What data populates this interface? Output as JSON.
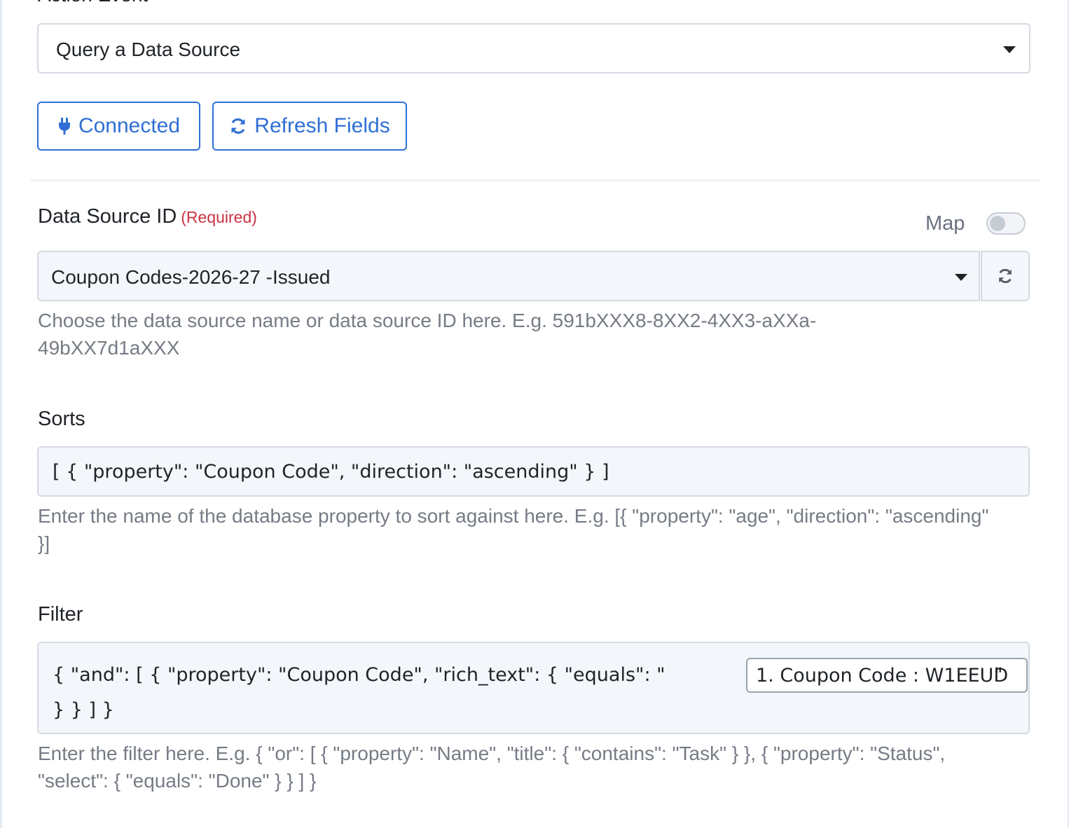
{
  "action_event": {
    "label": "Action Event",
    "selected": "Query a Data Source"
  },
  "buttons": {
    "connected": "Connected",
    "refresh_fields": "Refresh Fields"
  },
  "data_source": {
    "label": "Data Source ID",
    "required": "(Required)",
    "map_label": "Map",
    "map_enabled": false,
    "selected": "Coupon Codes-2026-27 -Issued",
    "help": "Choose the data source name or data source ID here. E.g. 591bXXX8-8XX2-4XX3-aXXa-49bXX7d1aXXX"
  },
  "sorts": {
    "label": "Sorts",
    "value": "[ { \"property\": \"Coupon Code\", \"direction\": \"ascending\" } ]",
    "help": "Enter the name of the database property to sort against here. E.g. [{ \"property\": \"age\", \"direction\": \"ascending\" }]"
  },
  "filter": {
    "label": "Filter",
    "value_line1_prefix": "{ \"and\": [ { \"property\": \"Coupon Code\", \"rich_text\": { \"equals\": \"",
    "mapped_token": "1. Coupon Code : W1EEUD",
    "value_line1_suffix": "\"",
    "value_line2": "} } ] }",
    "help": "Enter the filter here. E.g. { \"or\": [ { \"property\": \"Name\", \"title\": { \"contains\": \"Task\" } }, { \"property\": \"Status\", \"select\": { \"equals\": \"Done\" } } ] }"
  },
  "colors": {
    "accent": "#2f6fd6",
    "required": "#cc3344",
    "field_bg": "#f3f6fa",
    "border": "#d5dbe3",
    "help_text": "#767c85"
  }
}
